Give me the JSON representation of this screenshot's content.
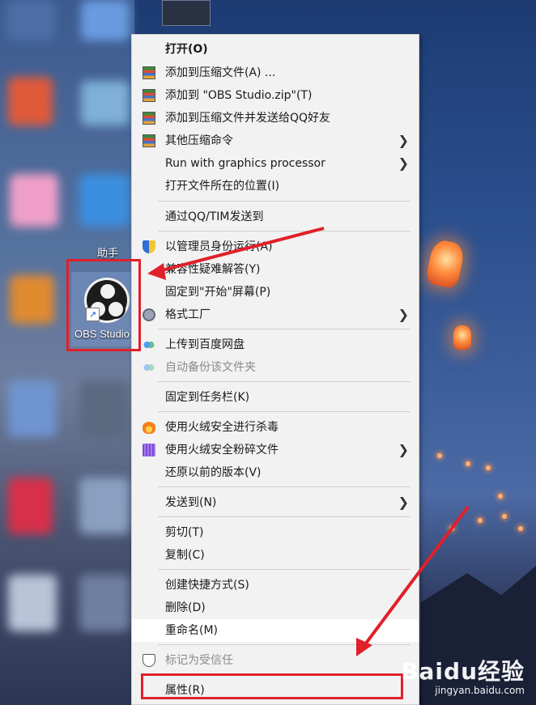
{
  "desktop": {
    "obs_label": "OBS Studio",
    "helper_label": "助手",
    "watermark_logo": "Baidu经验",
    "watermark_url": "jingyan.baidu.com"
  },
  "menu": {
    "items": [
      {
        "label": "打开(O)",
        "bold": true
      },
      {
        "label": "添加到压缩文件(A) ..."
      },
      {
        "label": "添加到 \"OBS Studio.zip\"(T)"
      },
      {
        "label": "添加到压缩文件并发送给QQ好友"
      },
      {
        "label": "其他压缩命令"
      },
      {
        "label": "Run with graphics processor"
      },
      {
        "label": "打开文件所在的位置(I)"
      },
      {
        "label": "通过QQ/TIM发送到"
      },
      {
        "label": "以管理员身份运行(A)"
      },
      {
        "label": "兼容性疑难解答(Y)"
      },
      {
        "label": "固定到\"开始\"屏幕(P)"
      },
      {
        "label": "格式工厂"
      },
      {
        "label": "上传到百度网盘"
      },
      {
        "label": "自动备份该文件夹"
      },
      {
        "label": "固定到任务栏(K)"
      },
      {
        "label": "使用火绒安全进行杀毒"
      },
      {
        "label": "使用火绒安全粉碎文件"
      },
      {
        "label": "还原以前的版本(V)"
      },
      {
        "label": "发送到(N)"
      },
      {
        "label": "剪切(T)"
      },
      {
        "label": "复制(C)"
      },
      {
        "label": "创建快捷方式(S)"
      },
      {
        "label": "删除(D)"
      },
      {
        "label": "重命名(M)"
      },
      {
        "label": "标记为受信任"
      },
      {
        "label": "属性(R)"
      }
    ]
  },
  "colors": {
    "annotation": "#e0202a",
    "menu_bg": "#f2f2f2"
  }
}
